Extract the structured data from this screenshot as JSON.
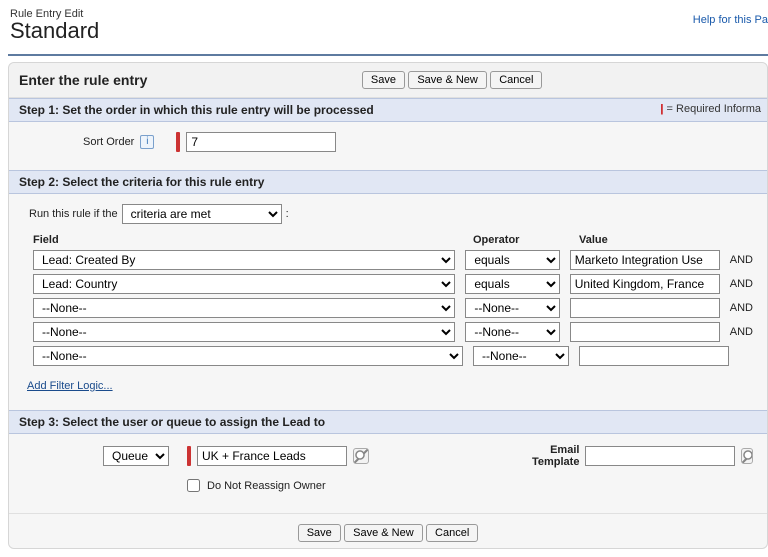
{
  "header": {
    "super": "Rule Entry Edit",
    "title": "Standard",
    "help": "Help for this Pa"
  },
  "panel_title": "Enter the rule entry",
  "buttons": {
    "save": "Save",
    "saveNew": "Save & New",
    "cancel": "Cancel"
  },
  "step1": {
    "title": "Step 1: Set the order in which this rule entry will be processed",
    "required": "= Required Informa",
    "sort_label": "Sort Order",
    "sort_value": "7"
  },
  "step2": {
    "title": "Step 2: Select the criteria for this rule entry",
    "run_label_pre": "Run this rule if the",
    "run_option": "criteria are met",
    "run_label_post": ":",
    "cols": {
      "field": "Field",
      "op": "Operator",
      "val": "Value"
    },
    "rows": [
      {
        "field": "Lead: Created By",
        "op": "equals",
        "val": "Marketo Integration Use",
        "and": "AND"
      },
      {
        "field": "Lead: Country",
        "op": "equals",
        "val": "United Kingdom, France",
        "and": "AND"
      },
      {
        "field": "--None--",
        "op": "--None--",
        "val": "",
        "and": "AND"
      },
      {
        "field": "--None--",
        "op": "--None--",
        "val": "",
        "and": "AND"
      },
      {
        "field": "--None--",
        "op": "--None--",
        "val": "",
        "and": ""
      }
    ],
    "add_filter": "Add Filter Logic..."
  },
  "step3": {
    "title": "Step 3: Select the user or queue to assign the Lead to",
    "assignee_type": "Queue",
    "assignee_value": "UK + France Leads",
    "email_label": "Email Template",
    "email_value": "",
    "noreassign": "Do Not Reassign Owner"
  }
}
